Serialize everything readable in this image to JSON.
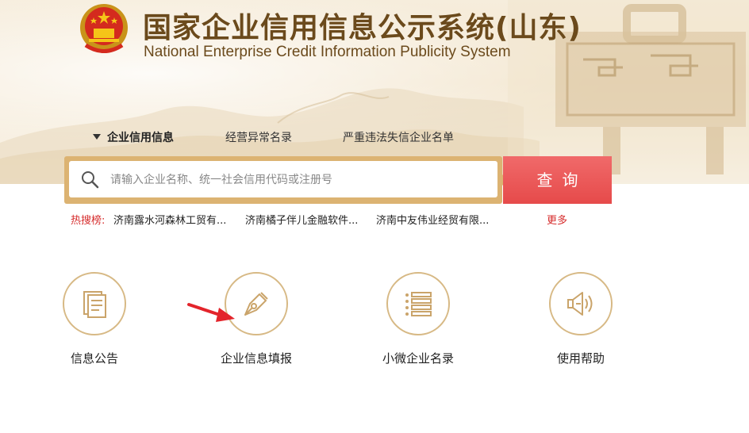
{
  "header": {
    "title_cn": "国家企业信用信息公示系统(山东)",
    "title_en": "National Enterprise Credit Information Publicity System"
  },
  "nav": {
    "tabs": [
      {
        "label": "企业信用信息",
        "active": true
      },
      {
        "label": "经营异常名录",
        "active": false
      },
      {
        "label": "严重违法失信企业名单",
        "active": false
      }
    ]
  },
  "search": {
    "placeholder": "请输入企业名称、统一社会信用代码或注册号",
    "value": "",
    "button_label": "查询"
  },
  "hot_search": {
    "label": "热搜榜:",
    "items": [
      "济南露水河森林工贸有...",
      "济南橘子伴儿金融软件...",
      "济南中友伟业经贸有限..."
    ],
    "more_label": "更多"
  },
  "features": [
    {
      "label": "信息公告",
      "icon": "document-icon"
    },
    {
      "label": "企业信息填报",
      "icon": "pen-nib-icon"
    },
    {
      "label": "小微企业名录",
      "icon": "list-icon"
    },
    {
      "label": "使用帮助",
      "icon": "speaker-icon"
    }
  ],
  "colors": {
    "brand_brown": "#6b4a1c",
    "search_frame": "#dcb372",
    "search_button": "#e64a4a",
    "hot_red": "#d62c2c",
    "circle_border": "#d7b985"
  }
}
